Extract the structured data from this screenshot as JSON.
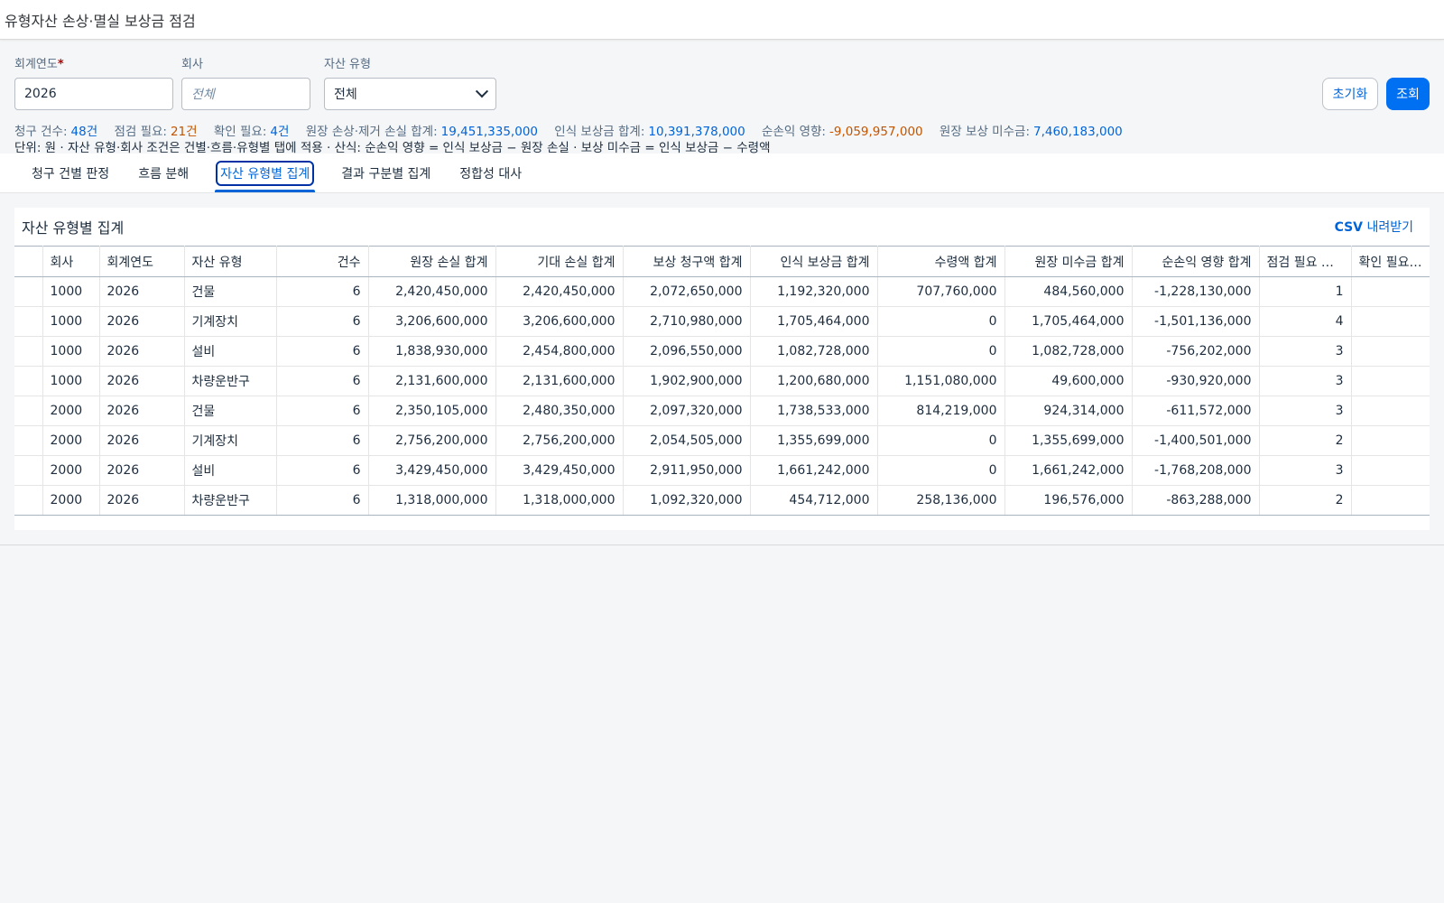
{
  "app": {
    "title": "유형자산 손상·멸실 보상금 점검"
  },
  "filters": {
    "year": {
      "label": "회계연도",
      "required_mark": "*",
      "value": "2026"
    },
    "company": {
      "label": "회사",
      "placeholder": "전체"
    },
    "asset_type": {
      "label": "자산 유형",
      "value": "전체"
    }
  },
  "actions": {
    "reset_label": "초기화",
    "search_label": "조회"
  },
  "summary": {
    "items": [
      {
        "key": "청구 건수:",
        "value": "48건",
        "color": "#0064d9"
      },
      {
        "key": "점검 필요:",
        "value": "21건",
        "color": "#c35500"
      },
      {
        "key": "확인 필요:",
        "value": "4건",
        "color": "#0064d9"
      },
      {
        "key": "원장 손상·제거 손실 합계:",
        "value": "19,451,335,000",
        "color": "#0064d9"
      },
      {
        "key": "인식 보상금 합계:",
        "value": "10,391,378,000",
        "color": "#0064d9"
      },
      {
        "key": "순손익 영향:",
        "value": "-9,059,957,000",
        "color": "#c35500"
      },
      {
        "key": "원장 보상 미수금:",
        "value": "7,460,183,000",
        "color": "#0064d9"
      }
    ],
    "note": "단위: 원 · 자산 유형·회사 조건은 건별·흐름·유형별 탭에 적용 · 산식: 순손익 영향 = 인식 보상금 − 원장 손실 · 보상 미수금 = 인식 보상금 − 수령액"
  },
  "tabs": [
    {
      "label": "청구 건별 판정",
      "active": false
    },
    {
      "label": "흐름 분해",
      "active": false
    },
    {
      "label": "자산 유형별 집계",
      "active": true
    },
    {
      "label": "결과 구분별 집계",
      "active": false
    },
    {
      "label": "정합성 대사",
      "active": false
    }
  ],
  "panel": {
    "title": "자산 유형별 집계",
    "csv_prefix": "CSV",
    "csv_suffix": " 내려받기"
  },
  "table": {
    "columns": [
      "",
      "회사",
      "회계연도",
      "자산 유형",
      "건수",
      "원장 손실 합계",
      "기대 손실 합계",
      "보상 청구액 합계",
      "인식 보상금 합계",
      "수령액 합계",
      "원장 미수금 합계",
      "순손익 영향 합계",
      "점검 필요 건수",
      "확인 필요 건수"
    ],
    "rows": [
      [
        "",
        "1000",
        "2026",
        "건물",
        "6",
        "2,420,450,000",
        "2,420,450,000",
        "2,072,650,000",
        "1,192,320,000",
        "707,760,000",
        "484,560,000",
        "-1,228,130,000",
        "1",
        ""
      ],
      [
        "",
        "1000",
        "2026",
        "기계장치",
        "6",
        "3,206,600,000",
        "3,206,600,000",
        "2,710,980,000",
        "1,705,464,000",
        "0",
        "1,705,464,000",
        "-1,501,136,000",
        "4",
        ""
      ],
      [
        "",
        "1000",
        "2026",
        "설비",
        "6",
        "1,838,930,000",
        "2,454,800,000",
        "2,096,550,000",
        "1,082,728,000",
        "0",
        "1,082,728,000",
        "-756,202,000",
        "3",
        ""
      ],
      [
        "",
        "1000",
        "2026",
        "차량운반구",
        "6",
        "2,131,600,000",
        "2,131,600,000",
        "1,902,900,000",
        "1,200,680,000",
        "1,151,080,000",
        "49,600,000",
        "-930,920,000",
        "3",
        ""
      ],
      [
        "",
        "2000",
        "2026",
        "건물",
        "6",
        "2,350,105,000",
        "2,480,350,000",
        "2,097,320,000",
        "1,738,533,000",
        "814,219,000",
        "924,314,000",
        "-611,572,000",
        "3",
        ""
      ],
      [
        "",
        "2000",
        "2026",
        "기계장치",
        "6",
        "2,756,200,000",
        "2,756,200,000",
        "2,054,505,000",
        "1,355,699,000",
        "0",
        "1,355,699,000",
        "-1,400,501,000",
        "2",
        ""
      ],
      [
        "",
        "2000",
        "2026",
        "설비",
        "6",
        "3,429,450,000",
        "3,429,450,000",
        "2,911,950,000",
        "1,661,242,000",
        "0",
        "1,661,242,000",
        "-1,768,208,000",
        "3",
        ""
      ],
      [
        "",
        "2000",
        "2026",
        "차량운반구",
        "6",
        "1,318,000,000",
        "1,318,000,000",
        "1,092,320,000",
        "454,712,000",
        "258,136,000",
        "196,576,000",
        "-863,288,000",
        "2",
        ""
      ]
    ]
  }
}
